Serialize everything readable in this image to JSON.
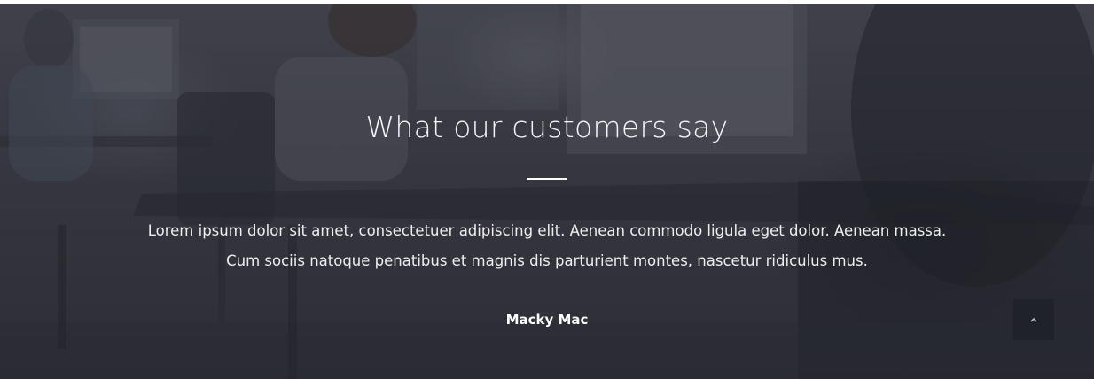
{
  "testimonials": {
    "title": "What our customers say",
    "quote": "Lorem ipsum dolor sit amet, consectetuer adipiscing elit. Aenean commodo ligula eget dolor. Aenean massa. Cum sociis natoque penatibus et magnis dis parturient montes, nascetur ridiculus mus.",
    "author": "Macky Mac"
  },
  "scroll_top": {
    "icon": "chevron-up-icon"
  },
  "colors": {
    "overlay": "#3c3d46",
    "text": "#ffffff"
  }
}
